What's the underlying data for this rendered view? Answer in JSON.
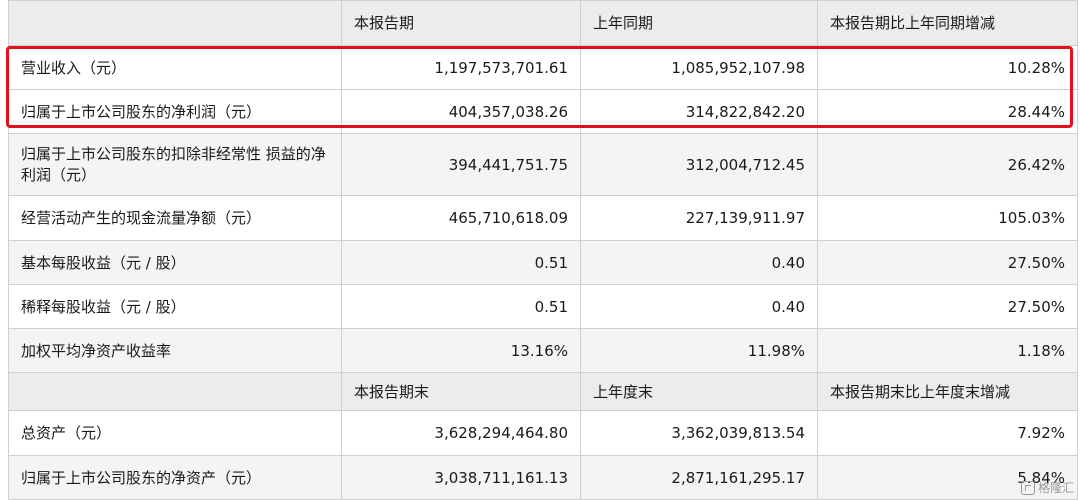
{
  "period_header": {
    "col1": "本报告期",
    "col2": "上年同期",
    "col3": "本报告期比上年同期增减"
  },
  "period_rows": [
    {
      "label": "营业收入（元）",
      "current": "1,197,573,701.61",
      "previous": "1,085,952,107.98",
      "change": "10.28%"
    },
    {
      "label": "归属于上市公司股东的净利润（元）",
      "current": "404,357,038.26",
      "previous": "314,822,842.20",
      "change": "28.44%"
    },
    {
      "label": "归属于上市公司股东的扣除非经常性 损益的净利润（元）",
      "current": "394,441,751.75",
      "previous": "312,004,712.45",
      "change": "26.42%"
    },
    {
      "label": "经营活动产生的现金流量净额（元）",
      "current": "465,710,618.09",
      "previous": "227,139,911.97",
      "change": "105.03%"
    },
    {
      "label": "基本每股收益（元 / 股）",
      "current": "0.51",
      "previous": "0.40",
      "change": "27.50%"
    },
    {
      "label": "稀释每股收益（元 / 股）",
      "current": "0.51",
      "previous": "0.40",
      "change": "27.50%"
    },
    {
      "label": "加权平均净资产收益率",
      "current": "13.16%",
      "previous": "11.98%",
      "change": "1.18%"
    }
  ],
  "balance_header": {
    "col1": "本报告期末",
    "col2": "上年度末",
    "col3": "本报告期末比上年度末增减"
  },
  "balance_rows": [
    {
      "label": "总资产（元）",
      "current": "3,628,294,464.80",
      "previous": "3,362,039,813.54",
      "change": "7.92%"
    },
    {
      "label": "归属于上市公司股东的净资产（元）",
      "current": "3,038,711,161.13",
      "previous": "2,871,161,295.17",
      "change": "5.84%"
    }
  ],
  "watermark": {
    "text": "格隆汇"
  },
  "colors": {
    "highlight_border": "#e3101e",
    "header_bg": "#ececec",
    "stripe_bg": "#f4f4f4"
  }
}
